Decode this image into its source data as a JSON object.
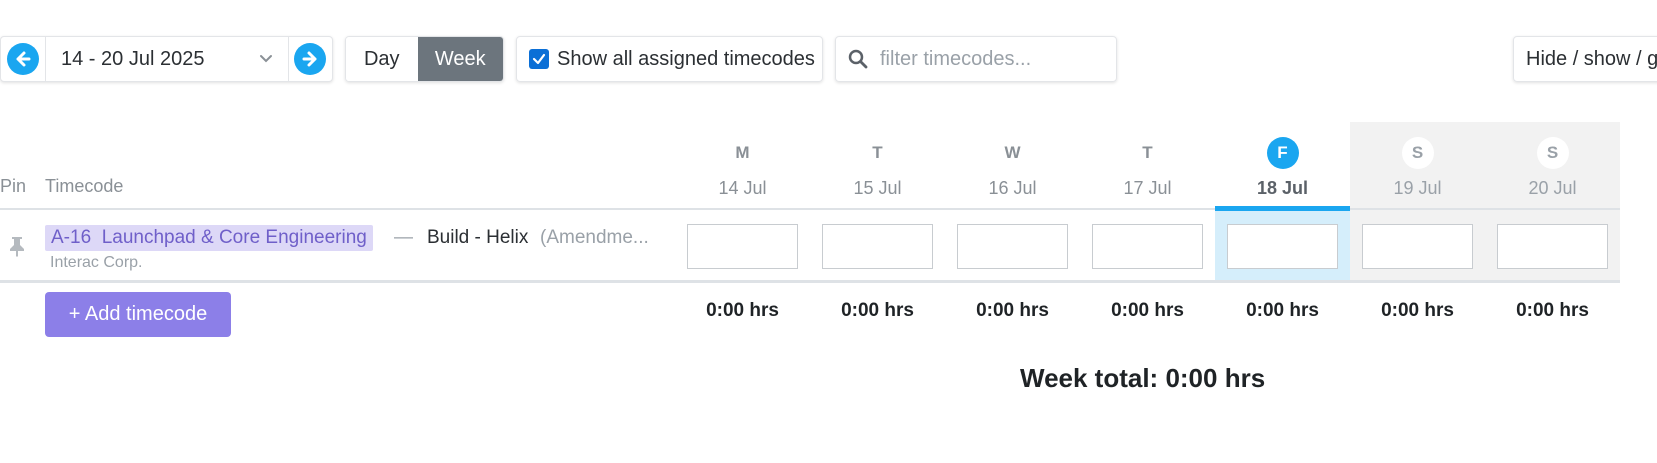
{
  "toolbar": {
    "date_range": "14 - 20 Jul 2025",
    "view_day": "Day",
    "view_week": "Week",
    "view_selected": "Week",
    "show_assigned_label": "Show all assigned timecodes",
    "show_assigned_checked": true,
    "search_placeholder": "filter timecodes...",
    "search_value": "",
    "hide_show_label": "Hide / show / g"
  },
  "grid": {
    "pin_header": "Pin",
    "timecode_header": "Timecode",
    "days": [
      {
        "letter": "M",
        "date": "14 Jul",
        "total": "0:00 hrs",
        "value": ""
      },
      {
        "letter": "T",
        "date": "15 Jul",
        "total": "0:00 hrs",
        "value": ""
      },
      {
        "letter": "W",
        "date": "16 Jul",
        "total": "0:00 hrs",
        "value": ""
      },
      {
        "letter": "T",
        "date": "17 Jul",
        "total": "0:00 hrs",
        "value": ""
      },
      {
        "letter": "F",
        "date": "18 Jul",
        "total": "0:00 hrs",
        "value": ""
      },
      {
        "letter": "S",
        "date": "19 Jul",
        "total": "0:00 hrs",
        "value": ""
      },
      {
        "letter": "S",
        "date": "20 Jul",
        "total": "0:00 hrs",
        "value": ""
      }
    ],
    "today": "18 Jul",
    "rows": [
      {
        "code": "A-16  Launchpad & Core Engineering",
        "separator": "—",
        "task": "Build - Helix",
        "note": "(Amendme...",
        "client": "Interac Corp."
      }
    ]
  },
  "add_timecode_label": "+ Add timecode",
  "week_total": "Week total: 0:00 hrs",
  "colors": {
    "accent": "#1aa6f0",
    "timecode_bg": "#ddd8f7",
    "timecode_text": "#6f5fc9",
    "add_button": "#8c7fe8",
    "week_active": "#6c757d"
  },
  "icons": {
    "prev": "arrow-left-circle-icon",
    "next": "arrow-right-circle-icon",
    "dropdown": "chevron-down-icon",
    "search": "search-icon",
    "pin": "pin-icon",
    "check": "check-icon"
  }
}
